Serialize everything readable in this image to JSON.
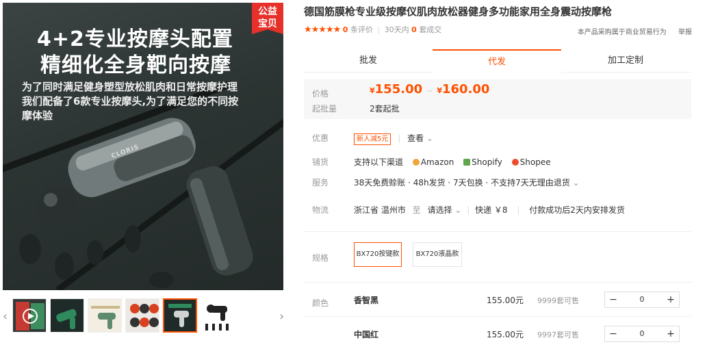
{
  "gallery": {
    "headline1": "4+2专业按摩头配置",
    "headline2": "精细化全身靶向按摩",
    "line1": "为了同时满足健身塑型放松肌肉和日常按摩护理",
    "line2": "我们配备了6款专业按摩头,为了满足您的不同按",
    "line3": "摩体验",
    "badge_line1": "公益",
    "badge_line2": "宝贝",
    "brand_on_device": "CLORIS"
  },
  "product": {
    "title": "德国筋膜枪专业级按摩仪肌肉放松器健身多功能家用全身震动按摩枪",
    "stars": "★★★★★",
    "reviews_count": "0",
    "reviews_label": "条评价",
    "sales_prefix": "30天内",
    "sales_count": "0",
    "sales_suffix": "套成交",
    "trade_note": "本产品采购属于商业贸易行为",
    "report": "举报"
  },
  "tabs": [
    "批发",
    "代发",
    "加工定制"
  ],
  "price": {
    "label": "价格",
    "currency": "¥",
    "low": "155.00",
    "sep": "~",
    "high": "160.00",
    "moq_label": "起批量",
    "moq": "2套起批"
  },
  "info": {
    "discount_label": "优惠",
    "coupon": "新人减5元",
    "view": "查看",
    "channel_label": "铺货",
    "channel_text": "支持以下渠道",
    "channels": [
      "Amazon",
      "Shopify",
      "Shopee"
    ],
    "service_label": "服务",
    "service_text": "38天免费赊账 · 48h发货 · 7天包换 · 不支持7天无理由退货",
    "logistics_label": "物流",
    "from": "浙江省 温州市",
    "to_word": "至",
    "select": "请选择",
    "express": "快递 ￥8",
    "ship_note": "付款成功后2天内安排发货"
  },
  "specs": {
    "label": "规格",
    "options": [
      "BX720按键款",
      "BX720液晶款"
    ]
  },
  "colors": {
    "label": "颜色",
    "rows": [
      {
        "name": "香智黑",
        "price": "155.00元",
        "stock": "9999套可售",
        "qty": "0"
      },
      {
        "name": "中国红",
        "price": "155.00元",
        "stock": "9997套可售",
        "qty": "0"
      }
    ]
  },
  "icons": {
    "prev": "chevron-left-icon",
    "next": "chevron-right-icon",
    "minus": "minus-icon",
    "plus": "plus-icon"
  },
  "accent": "#ff5000"
}
